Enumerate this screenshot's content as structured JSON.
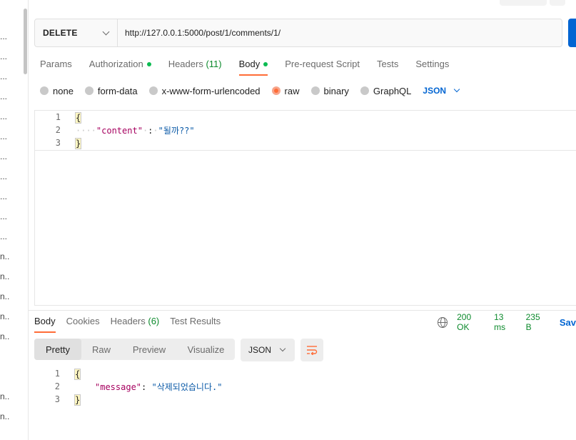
{
  "sidebar": {
    "stubs": [
      "...",
      "...",
      "...",
      "...",
      "...",
      "...",
      "...",
      "...",
      "...",
      "...",
      "...",
      "...",
      "n...",
      "n...",
      "n...",
      "n...",
      "n...",
      "n...",
      "n..."
    ]
  },
  "request": {
    "method": "DELETE",
    "url": "http://127.0.0.1:5000/post/1/comments/1/"
  },
  "request_tabs": [
    {
      "label": "Params"
    },
    {
      "label": "Authorization"
    },
    {
      "label": "Headers",
      "count": "(11)"
    },
    {
      "label": "Body"
    },
    {
      "label": "Pre-request Script"
    },
    {
      "label": "Tests"
    },
    {
      "label": "Settings"
    }
  ],
  "body_types": {
    "options": [
      "none",
      "form-data",
      "x-www-form-urlencoded",
      "raw",
      "binary",
      "GraphQL"
    ],
    "selected": "raw",
    "language": "JSON"
  },
  "request_body": {
    "line_numbers": [
      "1",
      "2",
      "3"
    ],
    "open_brace": "{",
    "close_brace": "}",
    "key": "\"content\"",
    "colon": ":",
    "value": "\"될까??\""
  },
  "response_tabs": [
    {
      "label": "Body"
    },
    {
      "label": "Cookies"
    },
    {
      "label": "Headers",
      "count": "(6)"
    },
    {
      "label": "Test Results"
    }
  ],
  "response_meta": {
    "status": "200 OK",
    "time": "13 ms",
    "size": "235 B",
    "save": "Sav"
  },
  "response_view": {
    "modes": [
      "Pretty",
      "Raw",
      "Preview",
      "Visualize"
    ],
    "active": "Pretty",
    "format": "JSON"
  },
  "response_body": {
    "line_numbers": [
      "1",
      "2",
      "3"
    ],
    "open_brace": "{",
    "close_brace": "}",
    "key": "\"message\"",
    "colon": ":",
    "value": "\"삭제되었습니다.\""
  },
  "colors": {
    "accent": "#ff6c37",
    "link_blue": "#0265d2",
    "status_green": "#0c8a2c"
  }
}
